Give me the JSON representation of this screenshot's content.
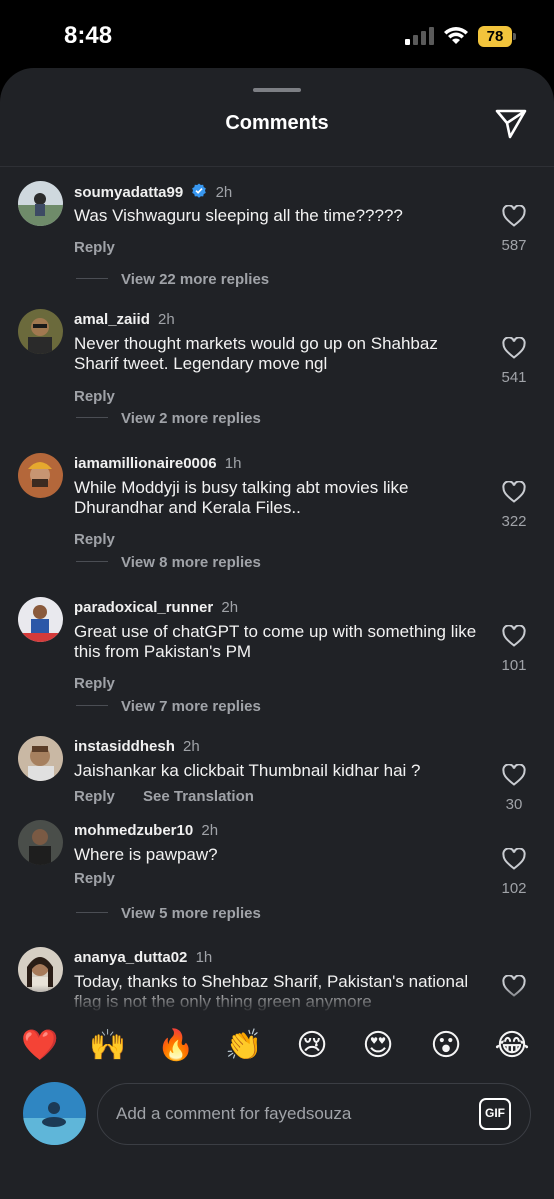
{
  "status_bar": {
    "time": "8:48",
    "battery": "78",
    "battery_color": "#f2c43c"
  },
  "sheet": {
    "title": "Comments",
    "share_icon": "paper-plane-icon"
  },
  "comments": [
    {
      "username": "soumyadatta99",
      "verified": true,
      "time": "2h",
      "text": "Was Vishwaguru sleeping all the time?????",
      "reply_label": "Reply",
      "likes": "587",
      "more_replies": "View 22 more replies"
    },
    {
      "username": "amal_zaiid",
      "time": "2h",
      "text": "Never thought markets would go up on Shahbaz Sharif tweet. Legendary move ngl",
      "reply_label": "Reply",
      "likes": "541",
      "more_replies": "View 2 more replies"
    },
    {
      "username": "iamamillionaire0006",
      "time": "1h",
      "text": "While Moddyji is busy talking abt movies like Dhurandhar and Kerala Files..",
      "reply_label": "Reply",
      "likes": "322",
      "more_replies": "View 8 more replies"
    },
    {
      "username": "paradoxical_runner",
      "time": "2h",
      "text": "Great use of chatGPT to come up with something like this from Pakistan's PM",
      "reply_label": "Reply",
      "likes": "101",
      "more_replies": "View 7 more replies"
    },
    {
      "username": "instasiddhesh",
      "time": "2h",
      "text": "Jaishankar ka clickbait Thumbnail kidhar hai ?",
      "reply_label": "Reply",
      "translate_label": "See Translation",
      "likes": "30"
    },
    {
      "username": "mohmedzuber10",
      "time": "2h",
      "text": "Where is pawpaw?",
      "reply_label": "Reply",
      "likes": "102",
      "more_replies": "View 5 more replies"
    },
    {
      "username": "ananya_dutta02",
      "time": "1h",
      "text": "Today, thanks to Shehbaz Sharif, Pakistan's national flag is not the only thing green anymore"
    }
  ],
  "reactions": [
    "❤️",
    "🙌",
    "🔥",
    "👏",
    "😢",
    "😍",
    "😮",
    "😂"
  ],
  "composer": {
    "placeholder": "Add a comment for fayedsouza",
    "gif_label": "GIF"
  }
}
